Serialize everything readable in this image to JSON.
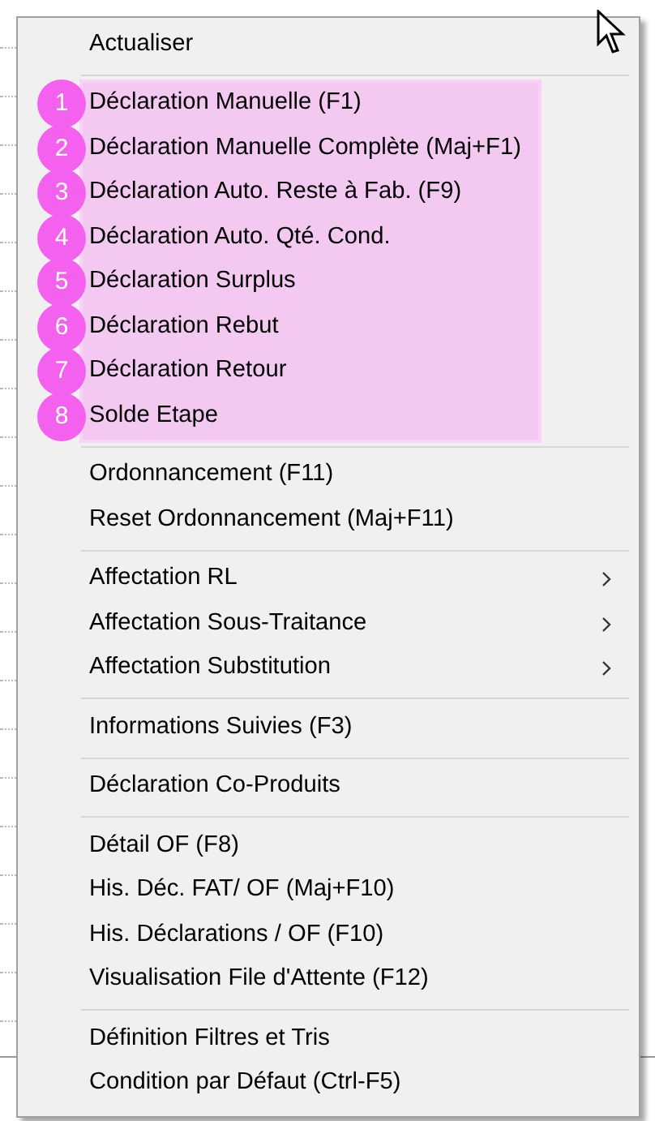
{
  "context_menu": {
    "sections": [
      {
        "highlighted": false,
        "items": [
          {
            "label": "Actualiser",
            "submenu": false
          }
        ]
      },
      {
        "highlighted": true,
        "items": [
          {
            "label": "Déclaration Manuelle (F1)",
            "badge": "1",
            "submenu": false
          },
          {
            "label": "Déclaration Manuelle Complète (Maj+F1)",
            "badge": "2",
            "submenu": false
          },
          {
            "label": "Déclaration Auto. Reste à Fab. (F9)",
            "badge": "3",
            "submenu": false
          },
          {
            "label": "Déclaration Auto. Qté. Cond.",
            "badge": "4",
            "submenu": false
          },
          {
            "label": "Déclaration Surplus",
            "badge": "5",
            "submenu": false
          },
          {
            "label": "Déclaration Rebut",
            "badge": "6",
            "submenu": false
          },
          {
            "label": "Déclaration Retour",
            "badge": "7",
            "submenu": false
          },
          {
            "label": "Solde Etape",
            "badge": "8",
            "submenu": false
          }
        ]
      },
      {
        "highlighted": false,
        "items": [
          {
            "label": "Ordonnancement (F11)",
            "submenu": false
          },
          {
            "label": "Reset Ordonnancement (Maj+F11)",
            "submenu": false
          }
        ]
      },
      {
        "highlighted": false,
        "items": [
          {
            "label": "Affectation RL",
            "submenu": true
          },
          {
            "label": "Affectation Sous-Traitance",
            "submenu": true
          },
          {
            "label": "Affectation Substitution",
            "submenu": true
          }
        ]
      },
      {
        "highlighted": false,
        "items": [
          {
            "label": "Informations Suivies (F3)",
            "submenu": false
          }
        ]
      },
      {
        "highlighted": false,
        "items": [
          {
            "label": "Déclaration Co-Produits",
            "submenu": false
          }
        ]
      },
      {
        "highlighted": false,
        "items": [
          {
            "label": "Détail OF (F8)",
            "submenu": false
          },
          {
            "label": "His. Déc. FAT/ OF (Maj+F10)",
            "submenu": false
          },
          {
            "label": "His. Déclarations / OF (F10)",
            "submenu": false
          },
          {
            "label": "Visualisation File d'Attente (F12)",
            "submenu": false
          }
        ]
      },
      {
        "highlighted": false,
        "items": [
          {
            "label": "Définition Filtres et Tris",
            "submenu": false
          },
          {
            "label": "Condition par Défaut (Ctrl-F5)",
            "submenu": false
          }
        ]
      }
    ]
  }
}
